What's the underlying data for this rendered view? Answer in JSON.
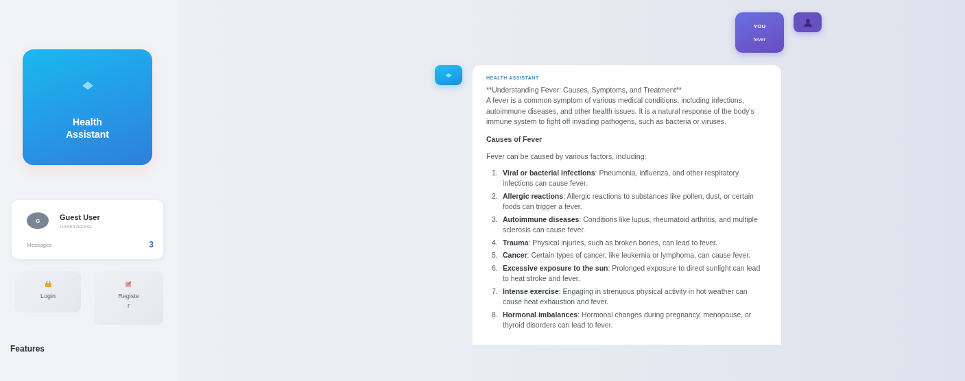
{
  "sidebar": {
    "logo": {
      "title": "Health Assistant"
    },
    "profile": {
      "initial": "G",
      "name": "Guest User",
      "role": "Limited Access",
      "stat_label": "Messages",
      "stat_value": "3"
    },
    "buttons": [
      {
        "kind": "login",
        "label": "Login"
      },
      {
        "kind": "register",
        "label": "Register"
      }
    ],
    "section_title": "Features"
  },
  "messages": [
    {
      "kind": "user",
      "sender": "YOU",
      "text": "fever"
    },
    {
      "kind": "assistant",
      "sender": "HEALTH ASSISTANT",
      "title": "**Understanding Fever: Causes, Symptoms, and Treatment**",
      "intro": "A fever is a common symptom of various medical conditions, including infections, autoimmune diseases, and other health issues. It is a natural response of the body's immune system to fight off invading pathogens, such as bacteria or viruses.",
      "heading": "Causes of Fever",
      "lead": "Fever can be caused by various factors, including:",
      "items": [
        {
          "number": "1.",
          "text": "**Viral or bacterial infections**: Pneumonia, influenza, and other respiratory infections can cause fever."
        },
        {
          "number": "2.",
          "text": "**Allergic reactions**: Allergic reactions to substances like pollen, dust, or certain foods can trigger a fever."
        },
        {
          "number": "3.",
          "text": "**Autoimmune diseases**: Conditions like lupus, rheumatoid arthritis, and multiple sclerosis can cause fever."
        },
        {
          "number": "4.",
          "text": "**Trauma**: Physical injuries, such as broken bones, can lead to fever."
        },
        {
          "number": "5.",
          "text": "**Cancer**: Certain types of cancer, like leukemia or lymphoma, can cause fever."
        },
        {
          "number": "6.",
          "text": "**Excessive exposure to the sun**: Prolonged exposure to direct sunlight can lead to heat stroke and fever."
        },
        {
          "number": "7.",
          "text": "**Intense exercise**: Engaging in strenuous physical activity in hot weather can cause heat exhaustion and fever."
        },
        {
          "number": "8.",
          "text": "**Hormonal imbalances**: Hormonal changes during pregnancy, menopause, or thyroid disorders can lead to fever."
        }
      ]
    }
  ]
}
